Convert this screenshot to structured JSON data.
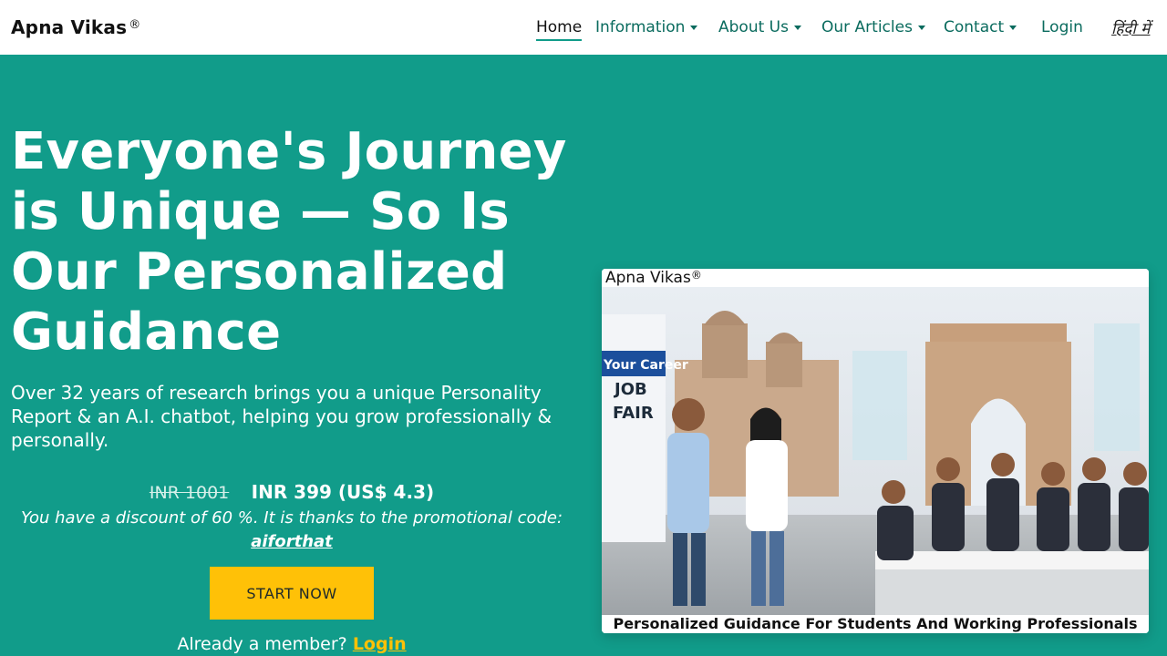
{
  "brand": {
    "name": "Apna Vikas",
    "mark": "®"
  },
  "nav": {
    "home": "Home",
    "information": "Information",
    "about": "About Us",
    "articles": "Our Articles",
    "contact": "Contact",
    "login": "Login",
    "hindi": "हिंदी में"
  },
  "hero": {
    "title": "Everyone's Journey is Unique — So Is Our Personalized Guidance",
    "subtitle": "Over 32 years of research brings you a unique Personality Report & an A.I. chatbot, helping you grow professionally & personally.",
    "old_price": "INR 1001",
    "new_price": "INR 399 (US$ 4.3)",
    "discount_text": "You have a discount of 60 %. It is thanks to the promotional code:",
    "promo_code": "aiforthat",
    "start_button": "START NOW",
    "member_text": "Already a member?",
    "member_login": "Login"
  },
  "image_card": {
    "logo": "Apna Vikas",
    "logo_mark": "®",
    "sign_line1": "Your Career",
    "sign_line2": "JOB",
    "sign_line3": "FAIR",
    "caption": "Personalized Guidance For Students And Working Professionals"
  },
  "colors": {
    "primary": "#119c8a",
    "accent": "#ffc107",
    "nav_text": "#0a6b5e"
  }
}
